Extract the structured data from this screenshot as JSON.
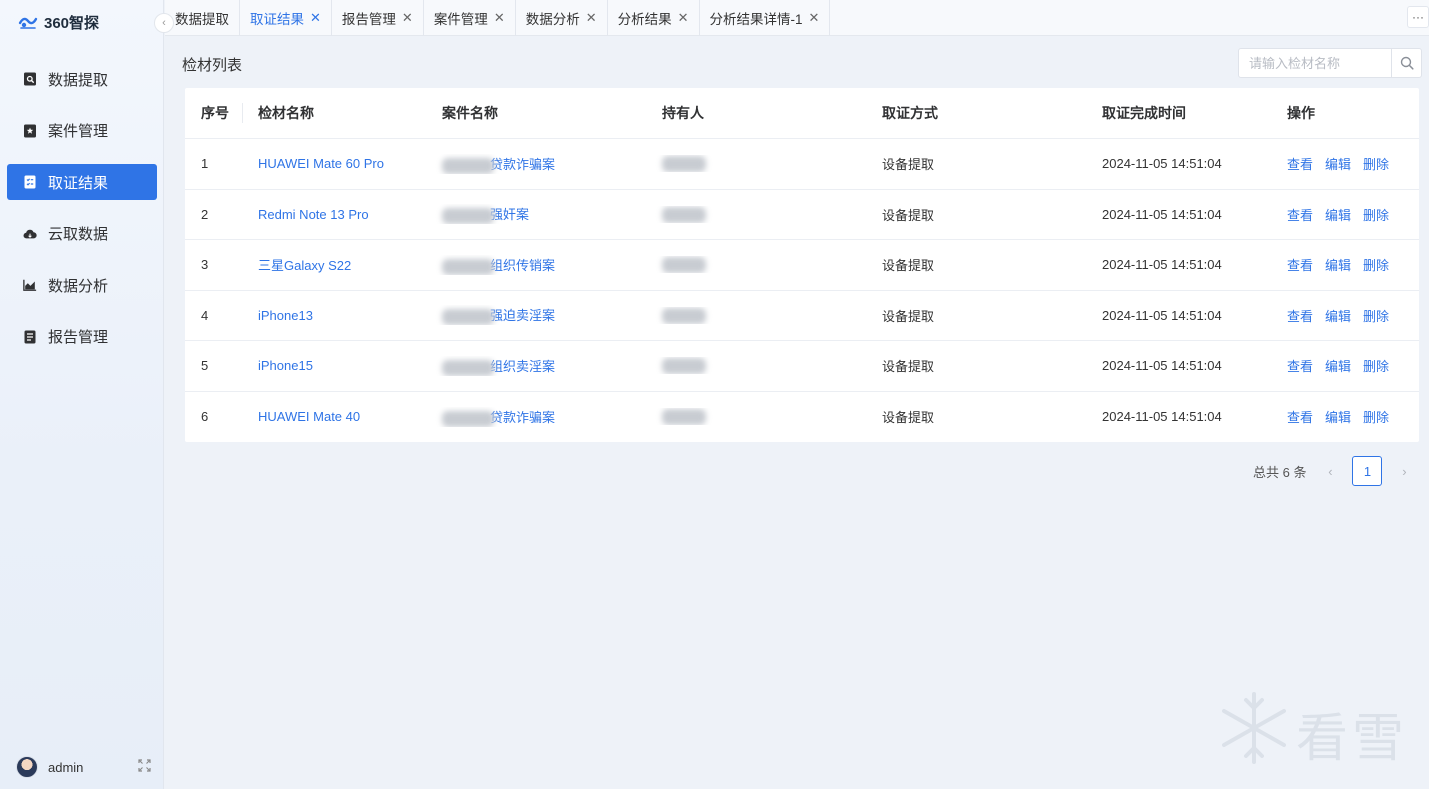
{
  "app": {
    "name": "360智探"
  },
  "sidebar": {
    "items": [
      {
        "label": "数据提取",
        "icon": "search-doc-icon",
        "active": false
      },
      {
        "label": "案件管理",
        "icon": "star-doc-icon",
        "active": false
      },
      {
        "label": "取证结果",
        "icon": "checklist-icon",
        "active": true
      },
      {
        "label": "云取数据",
        "icon": "cloud-icon",
        "active": false
      },
      {
        "label": "数据分析",
        "icon": "chart-icon",
        "active": false
      },
      {
        "label": "报告管理",
        "icon": "report-icon",
        "active": false
      }
    ],
    "user": {
      "name": "admin"
    }
  },
  "tabs": [
    {
      "label": "数据提取",
      "closable": false,
      "active": false
    },
    {
      "label": "取证结果",
      "closable": true,
      "active": true
    },
    {
      "label": "报告管理",
      "closable": true,
      "active": false
    },
    {
      "label": "案件管理",
      "closable": true,
      "active": false
    },
    {
      "label": "数据分析",
      "closable": true,
      "active": false
    },
    {
      "label": "分析结果",
      "closable": true,
      "active": false
    },
    {
      "label": "分析结果详情-1",
      "closable": true,
      "active": false
    }
  ],
  "main": {
    "title": "检材列表",
    "search": {
      "placeholder": "请输入检材名称",
      "value": ""
    },
    "table": {
      "columns": [
        "序号",
        "检材名称",
        "案件名称",
        "持有人",
        "取证方式",
        "取证完成时间",
        "操作"
      ],
      "rows": [
        {
          "index": "1",
          "device": "HUAWEI Mate 60 Pro",
          "case_suffix": "贷款诈骗案",
          "method": "设备提取",
          "time": "2024-11-05 14:51:04"
        },
        {
          "index": "2",
          "device": "Redmi Note 13 Pro",
          "case_suffix": "强奸案",
          "method": "设备提取",
          "time": "2024-11-05 14:51:04"
        },
        {
          "index": "3",
          "device": "三星Galaxy S22",
          "case_suffix": "组织传销案",
          "method": "设备提取",
          "time": "2024-11-05 14:51:04"
        },
        {
          "index": "4",
          "device": "iPhone13",
          "case_suffix": "强迫卖淫案",
          "method": "设备提取",
          "time": "2024-11-05 14:51:04"
        },
        {
          "index": "5",
          "device": "iPhone15",
          "case_suffix": "组织卖淫案",
          "method": "设备提取",
          "time": "2024-11-05 14:51:04"
        },
        {
          "index": "6",
          "device": "HUAWEI Mate 40",
          "case_suffix": "贷款诈骗案",
          "method": "设备提取",
          "time": "2024-11-05 14:51:04"
        }
      ],
      "actions": {
        "view": "查看",
        "edit": "编辑",
        "delete": "删除"
      }
    },
    "pagination": {
      "total_text": "总共 6 条",
      "current_page": "1"
    }
  },
  "watermark": {
    "text": "看雪"
  },
  "colors": {
    "primary": "#2f74e6",
    "background": "#eef2f8"
  }
}
